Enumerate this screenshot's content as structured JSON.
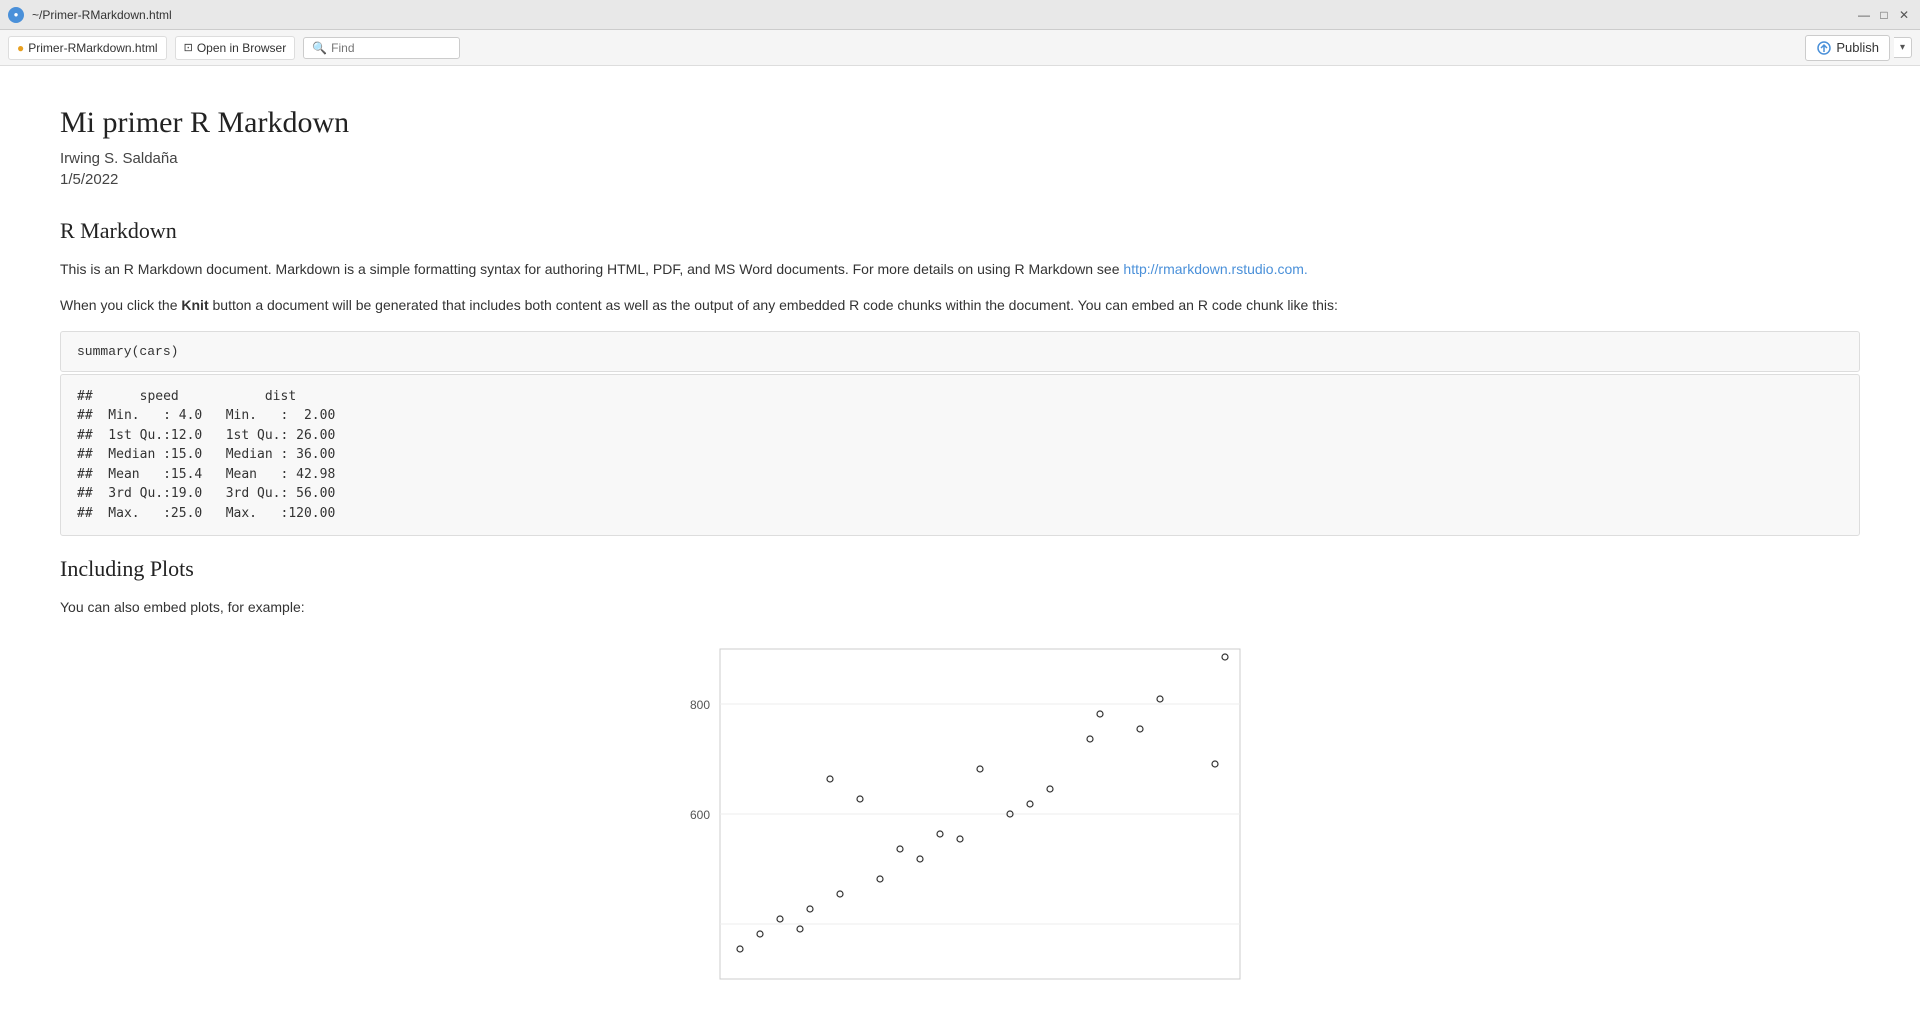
{
  "titlebar": {
    "icon_label": "●",
    "path": "~/Primer-RMarkdown.html",
    "window_controls": {
      "minimize": "—",
      "maximize": "□",
      "close": "✕"
    }
  },
  "toolbar": {
    "tab_label": "Primer-RMarkdown.html",
    "open_browser_label": "Open in Browser",
    "find_placeholder": "Find",
    "publish_label": "Publish",
    "publish_dropdown": "▾"
  },
  "document": {
    "title": "Mi primer R Markdown",
    "author": "Irwing S. Saldaña",
    "date": "1/5/2022",
    "section1_title": "R Markdown",
    "paragraph1": "This is an R Markdown document. Markdown is a simple formatting syntax for authoring HTML, PDF, and MS Word documents. For more details on using R Markdown see ",
    "link_text": "http://rmarkdown.rstudio.com.",
    "link_href": "http://rmarkdown.rstudio.com",
    "paragraph2_before": "When you click the ",
    "knit_bold": "Knit",
    "paragraph2_after": " button a document will be generated that includes both content as well as the output of any embedded R code chunks within the document. You can embed an R code chunk like this:",
    "code_block": "summary(cars)",
    "output_lines": [
      "##      speed           dist       ",
      "##  Min.   : 4.0   Min.   :  2.00  ",
      "##  1st Qu.:12.0   1st Qu.: 26.00  ",
      "##  Median :15.0   Median : 36.00  ",
      "##  Mean   :15.4   Mean   : 42.98  ",
      "##  3rd Qu.:19.0   3rd Qu.: 56.00  ",
      "##  Max.   :25.0   Max.   :120.00  "
    ],
    "section2_title": "Including Plots",
    "paragraph3": "You can also embed plots, for example:",
    "plot_y_label_top": "800",
    "plot_y_label_mid": "600"
  }
}
